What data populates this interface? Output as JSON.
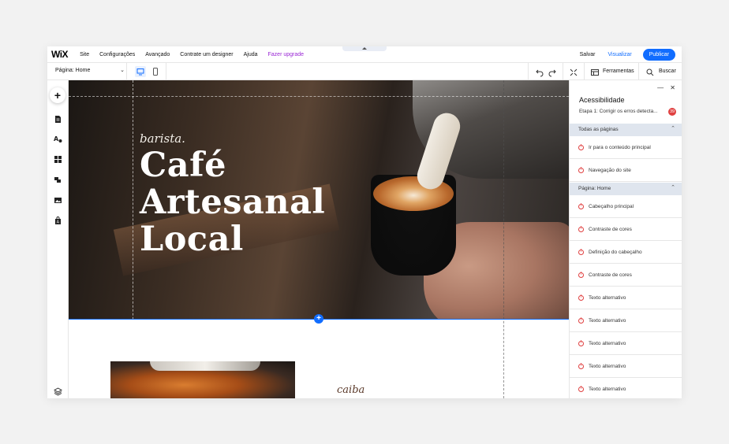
{
  "topbar": {
    "logo": "WiX",
    "menu": [
      "Site",
      "Configurações",
      "Avançado",
      "Contrate um designer",
      "Ajuda",
      "Fazer upgrade"
    ],
    "save": "Salvar",
    "preview": "Visualizar",
    "publish": "Publicar"
  },
  "toolbar2": {
    "page_label": "Página: Home",
    "tools": "Ferramentas",
    "search": "Buscar"
  },
  "hero": {
    "script": "barista.",
    "headline_1": "Café",
    "headline_2": "Artesanal",
    "headline_3": "Local"
  },
  "section2": {
    "script": "caiba"
  },
  "panel": {
    "title": "Acessibilidade",
    "step": "Etapa 1: Corrigir os erros detecta...",
    "badge": "39",
    "section_all": "Todas as páginas",
    "all_items": [
      "Ir para o conteúdo principal",
      "Navegação do site"
    ],
    "section_page": "Página: Home",
    "page_items": [
      "Cabeçalho principal",
      "Contraste de cores",
      "Definição do cabeçalho",
      "Contraste de cores",
      "Texto alternativo",
      "Texto alternativo",
      "Texto alternativo",
      "Texto alternativo",
      "Texto alternativo"
    ]
  },
  "colors": {
    "accent": "#116dff",
    "upgrade": "#9a27d5",
    "error": "#e04040"
  }
}
